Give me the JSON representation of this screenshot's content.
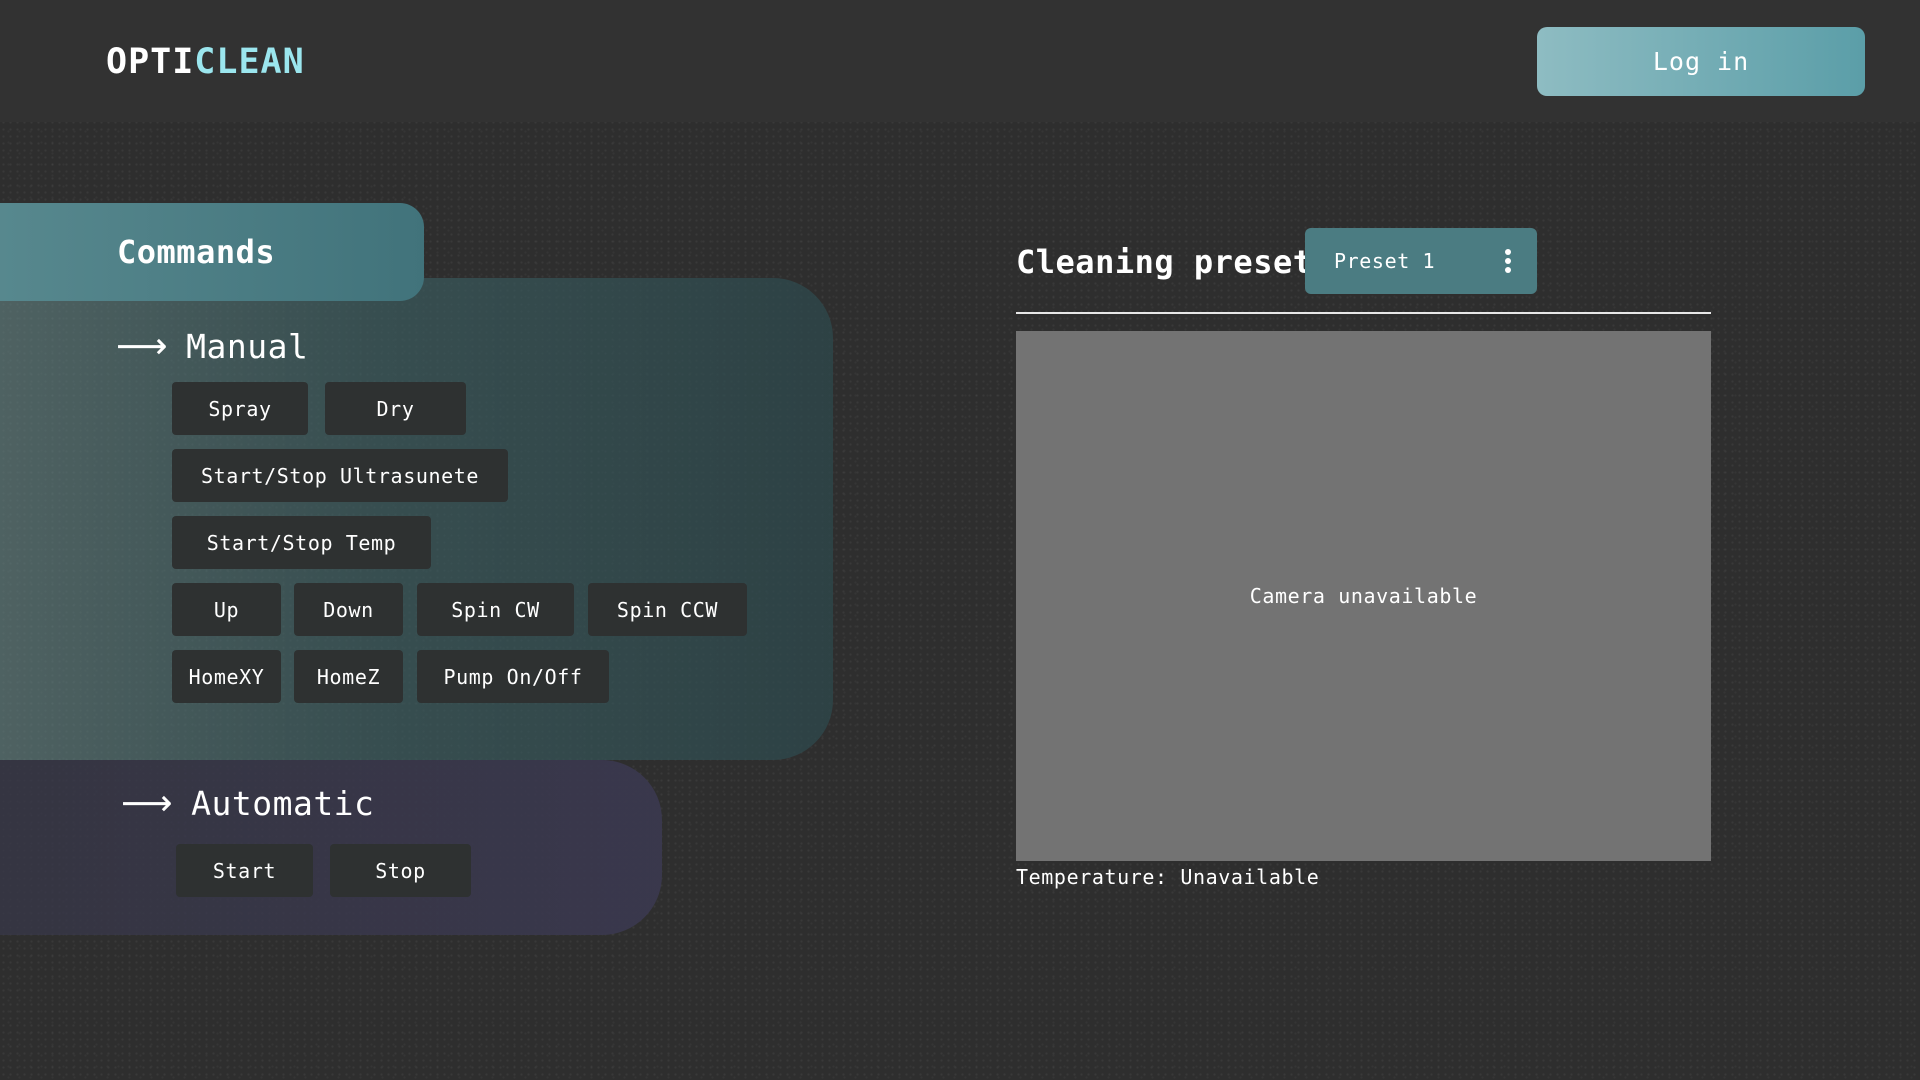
{
  "header": {
    "logo_part1": "OPTI",
    "logo_part2": "CLEAN",
    "login_label": "Log in"
  },
  "commands": {
    "title": "Commands",
    "manual": {
      "heading": "Manual",
      "buttons": {
        "spray": "Spray",
        "dry": "Dry",
        "ultrasound": "Start/Stop Ultrasunete",
        "temp": "Start/Stop Temp",
        "up": "Up",
        "down": "Down",
        "spin_cw": "Spin CW",
        "spin_ccw": "Spin CCW",
        "home_xy": "HomeXY",
        "home_z": "HomeZ",
        "pump": "Pump On/Off"
      }
    },
    "automatic": {
      "heading": "Automatic",
      "buttons": {
        "start": "Start",
        "stop": "Stop"
      }
    }
  },
  "preset": {
    "label": "Cleaning preset",
    "selected": "Preset 1"
  },
  "camera": {
    "status": "Camera unavailable"
  },
  "temperature": {
    "text": "Temperature: Unavailable"
  },
  "icons": {
    "arrow": "right-arrow-icon",
    "menu": "kebab-menu-icon"
  },
  "colors": {
    "background": "#2e2e2e",
    "header": "#323232",
    "accent": "#9be6ee",
    "login_button": "#6fa9b1",
    "commands_tab": "#4a7f86",
    "preset_select": "#4b7c82",
    "camera_placeholder": "#737373",
    "command_button": "#2e3131"
  }
}
